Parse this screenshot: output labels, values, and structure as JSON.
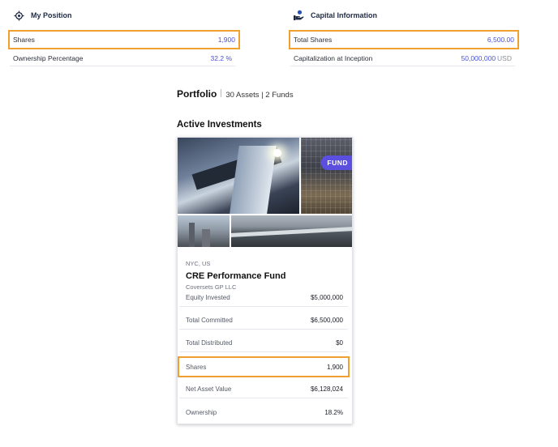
{
  "my_position": {
    "title": "My Position",
    "icon": "crosshair-icon",
    "rows": [
      {
        "label": "Shares",
        "value": "1,900",
        "unit": ""
      },
      {
        "label": "Ownership Percentage",
        "value": "32.2",
        "unit": "%"
      }
    ]
  },
  "capital_information": {
    "title": "Capital Information",
    "icon": "hand-coins-icon",
    "rows": [
      {
        "label": "Total Shares",
        "value": "6,500.00",
        "unit": ""
      },
      {
        "label": "Capitalization at Inception",
        "value": "50,000,000",
        "unit": "USD"
      }
    ]
  },
  "portfolio": {
    "title": "Portfolio",
    "summary": "30 Assets | 2 Funds"
  },
  "active_investments": {
    "title": "Active Investments",
    "card": {
      "badge": "FUND",
      "location": "NYC, US",
      "name": "CRE Performance Fund",
      "gp": "Coversets GP LLC",
      "rows": [
        {
          "label": "Equity Invested",
          "value": "$5,000,000"
        },
        {
          "label": "Total Committed",
          "value": "$6,500,000"
        },
        {
          "label": "Total Distributed",
          "value": "$0"
        },
        {
          "label": "Shares",
          "value": "1,900"
        },
        {
          "label": "Net Asset Value",
          "value": "$6,128,024"
        },
        {
          "label": "Ownership",
          "value": "18.2%"
        }
      ]
    }
  },
  "colors": {
    "accent": "#4a52d6",
    "highlight": "#f0a030",
    "badge": "#5b4fe0"
  }
}
